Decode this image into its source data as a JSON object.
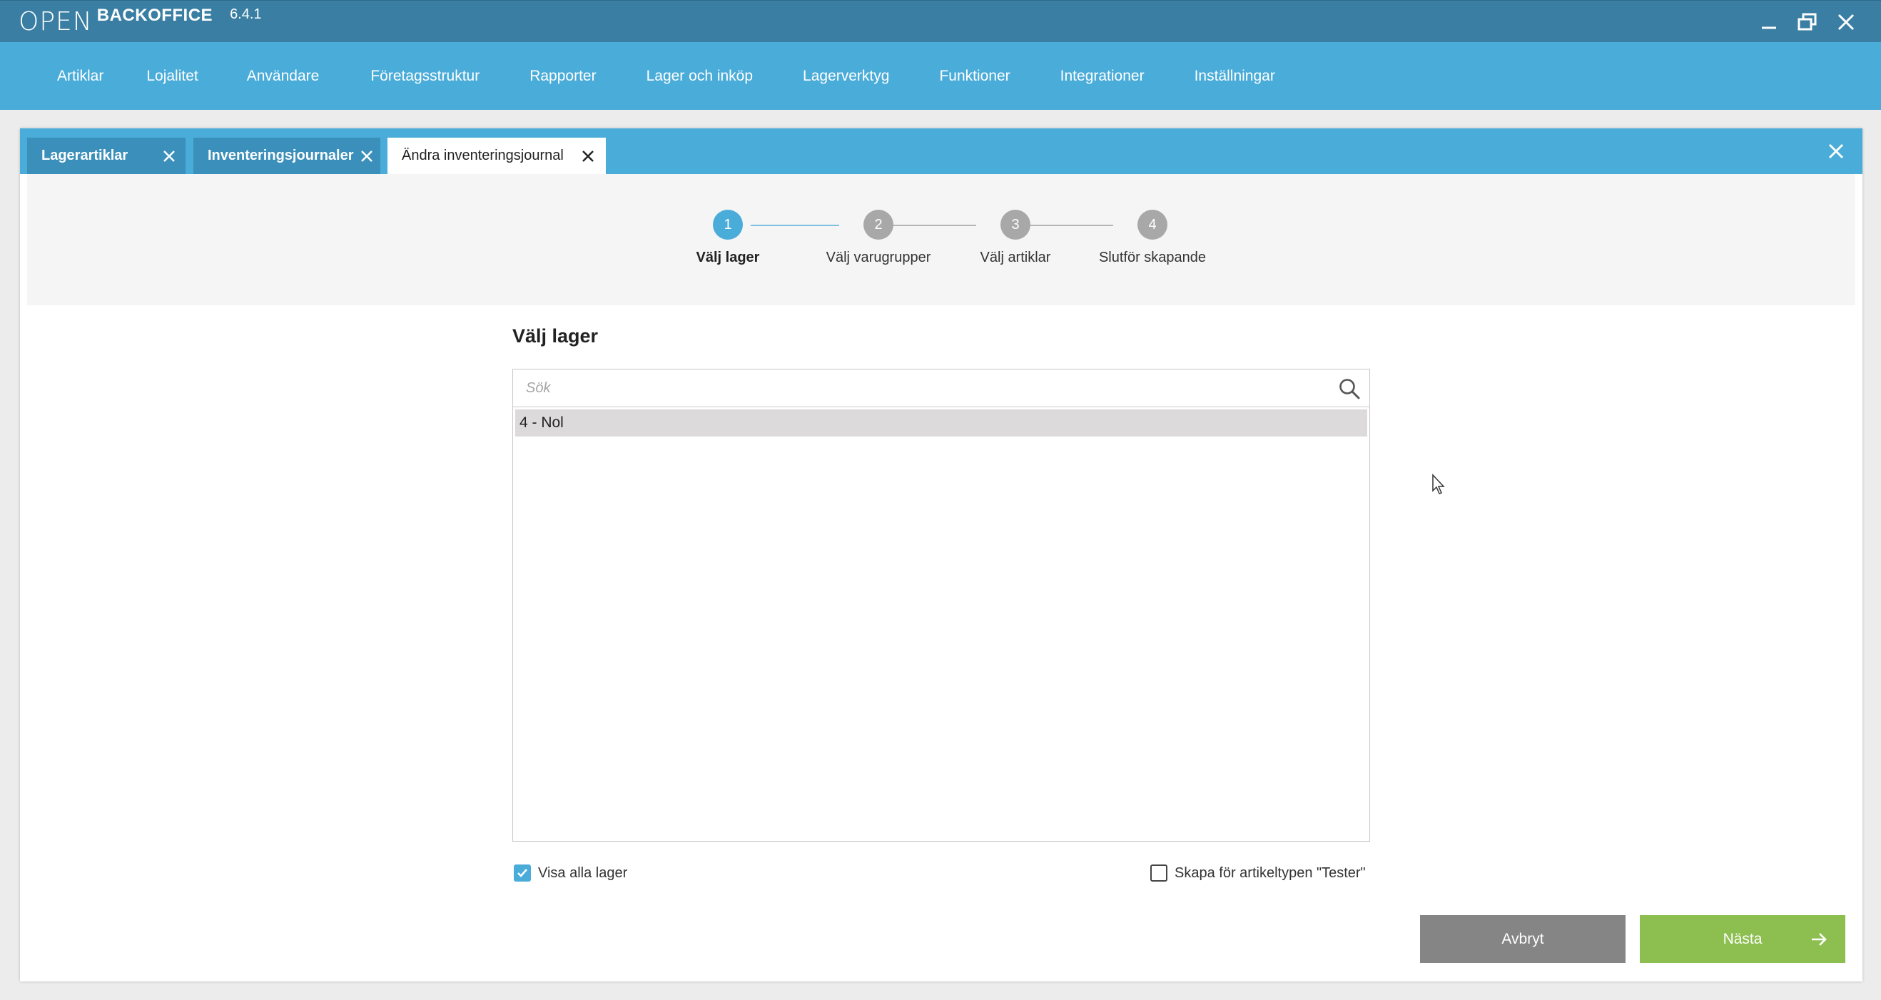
{
  "app": {
    "logo_mark": "OPEN",
    "logo_text": "BACKOFFICE",
    "version": "6.4.1"
  },
  "window_controls": {
    "minimize": "minimize-icon",
    "restore": "restore-icon",
    "close": "close-icon"
  },
  "menu": {
    "items": [
      {
        "label": "Artiklar"
      },
      {
        "label": "Lojalitet"
      },
      {
        "label": "Användare"
      },
      {
        "label": "Företagsstruktur"
      },
      {
        "label": "Rapporter"
      },
      {
        "label": "Lager och inköp"
      },
      {
        "label": "Lagerverktyg"
      },
      {
        "label": "Funktioner"
      },
      {
        "label": "Integrationer"
      },
      {
        "label": "Inställningar"
      }
    ]
  },
  "tabs": [
    {
      "label": "Lagerartiklar",
      "active": false
    },
    {
      "label": "Inventeringsjournaler",
      "active": false
    },
    {
      "label": "Ändra inventeringsjournal",
      "active": true
    }
  ],
  "stepper": {
    "current_step": 1,
    "steps": [
      {
        "number": "1",
        "label": "Välj lager"
      },
      {
        "number": "2",
        "label": "Välj varugrupper"
      },
      {
        "number": "3",
        "label": "Välj artiklar"
      },
      {
        "number": "4",
        "label": "Slutför skapande"
      }
    ]
  },
  "content": {
    "title": "Välj lager",
    "search": {
      "placeholder": "Sök",
      "value": ""
    },
    "list_items": [
      {
        "label": "4 - Nol",
        "selected": true
      }
    ],
    "show_all_checkbox": {
      "label": "Visa alla lager",
      "checked": true
    },
    "tester_checkbox": {
      "label": "Skapa för artikeltypen \"Tester\"",
      "checked": false
    }
  },
  "buttons": {
    "cancel": "Avbryt",
    "next": "Nästa"
  },
  "colors": {
    "titlebar": "#3a7fa3",
    "menubar": "#4aacd9",
    "accent": "#4aacd9",
    "next_button": "#8cbf4f",
    "cancel_button": "#858585"
  }
}
